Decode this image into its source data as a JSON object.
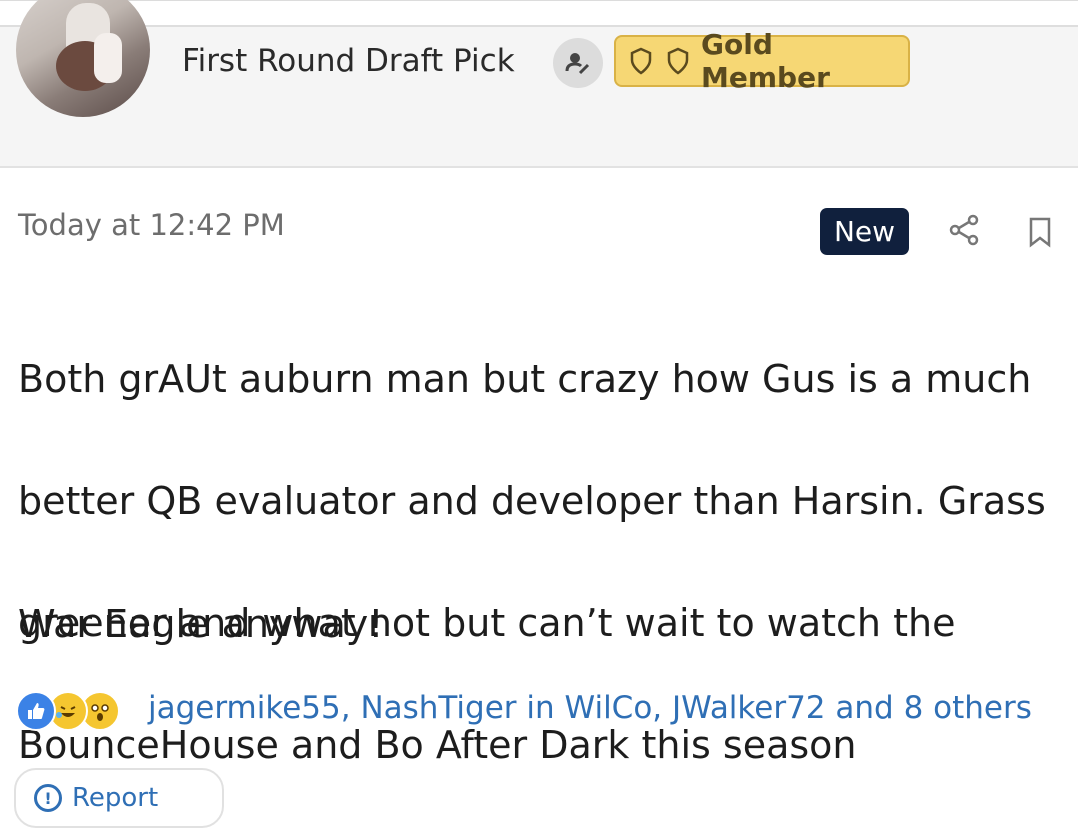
{
  "header": {
    "username": "First Round Draft Pick",
    "badge_label": "Gold Member"
  },
  "post": {
    "timestamp": "Today at 12:42 PM",
    "new_label": "New",
    "body_lines": [
      "Both grAUt auburn man but crazy how Gus is a much",
      "better QB evaluator and developer than Harsin. Grass",
      "greener and what not but can’t wait to watch the",
      "BounceHouse and Bo After Dark this season"
    ],
    "signoff": "War Eagle anyway!",
    "reactions": {
      "icons": [
        "like-reaction-icon",
        "laugh-reaction-icon",
        "wow-reaction-icon"
      ],
      "names_text": "jagermike55, NashTiger in WilCo, JWalker72 and 8 others"
    },
    "report_label": "Report"
  },
  "colors": {
    "gold_badge_bg": "#f6d774",
    "new_badge_bg": "#10203d",
    "link_blue": "#2f6fb5",
    "like_blue": "#3b82e6"
  }
}
